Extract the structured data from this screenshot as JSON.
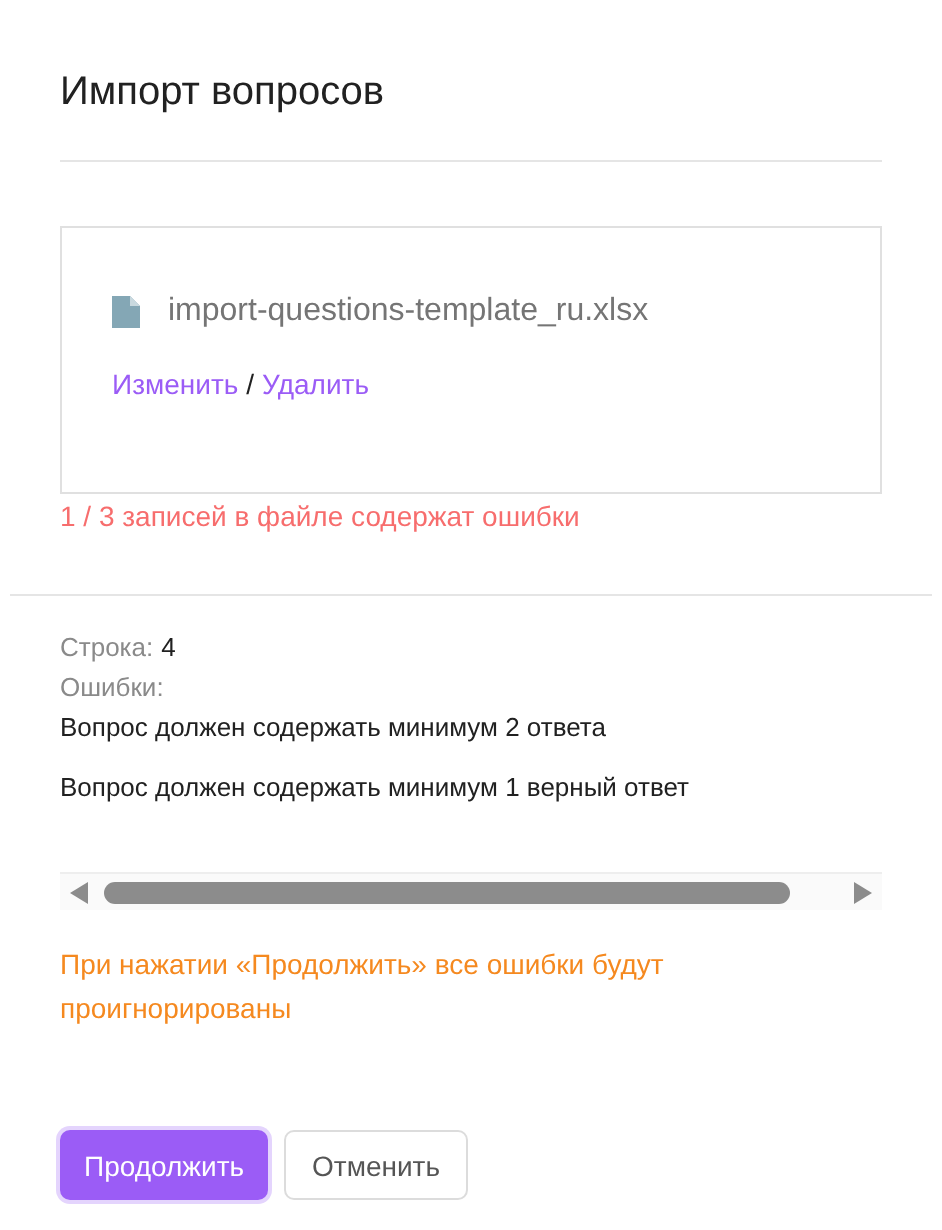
{
  "title": "Импорт вопросов",
  "file": {
    "name": "import-questions-template_ru.xlsx",
    "actions": [
      "Изменить",
      "Удалить"
    ],
    "separator": "/"
  },
  "error_summary": "1 / 3 записей в файле содержат ошибки",
  "details": {
    "row_label": "Строка:",
    "row_value": "4",
    "errors_label": "Ошибки:",
    "errors": [
      "Вопрос должен содержать минимум 2 ответа",
      "Вопрос должен содержать минимум 1 верный ответ"
    ]
  },
  "warning": "При нажатии «Продолжить» все ошибки будут проигнорированы",
  "buttons": [
    {
      "label": "Продолжить",
      "kind": "primary"
    },
    {
      "label": "Отменить",
      "kind": "secondary"
    }
  ]
}
